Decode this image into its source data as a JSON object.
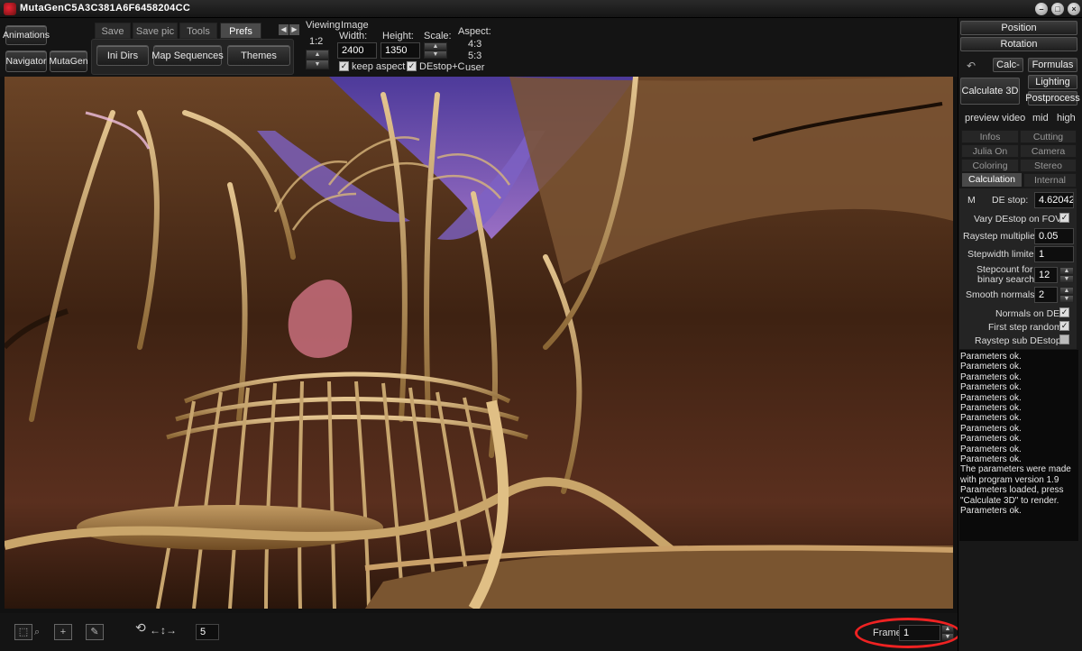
{
  "window": {
    "title": "MutaGenC5A3C381A6F6458204CC"
  },
  "left_buttons": {
    "animations": "Animations",
    "navigator": "Navigator",
    "mutagen": "MutaGen"
  },
  "tabs": [
    {
      "label": "Save",
      "active": false
    },
    {
      "label": "Save pic",
      "active": false
    },
    {
      "label": "Tools",
      "active": false
    },
    {
      "label": "Prefs",
      "active": true
    }
  ],
  "prefs_buttons": {
    "ini_dirs": "Ini Dirs",
    "map_sequences": "Map Sequences",
    "themes": "Themes"
  },
  "viewing": {
    "label": "Viewing",
    "ratio": "1:2"
  },
  "image": {
    "label": "Image",
    "width_label": "Width:",
    "width": "2400",
    "height_label": "Height:",
    "height": "1350",
    "scale_label": "Scale:",
    "aspect_label": "Aspect:",
    "aspect_options": [
      "4:3",
      "5:3",
      "user"
    ],
    "keep_aspect_label": "keep aspect",
    "keep_aspect": true,
    "destop_label": "DEstop+C",
    "destop": true
  },
  "right": {
    "position": "Position",
    "rotation": "Rotation",
    "calc": "Calc-",
    "formulas": "Formulas",
    "calculate3d": "Calculate 3D",
    "lighting": "Lighting",
    "postprocess": "Postprocess",
    "quality": [
      "preview",
      "video",
      "mid",
      "high"
    ],
    "tabs": [
      {
        "label": "Infos",
        "active": false
      },
      {
        "label": "Cutting",
        "active": false
      },
      {
        "label": "Julia On",
        "active": false
      },
      {
        "label": "Camera",
        "active": false
      },
      {
        "label": "Coloring",
        "active": false
      },
      {
        "label": "Stereo",
        "active": false
      },
      {
        "label": "Calculation",
        "active": true
      },
      {
        "label": "Internal",
        "active": false
      }
    ]
  },
  "calc_params": {
    "m_label": "M",
    "de_stop_label": "DE stop:",
    "de_stop": "4.62042",
    "vary_label": "Vary DEstop on FOV:",
    "vary": true,
    "raystep_label": "Raystep multiplier:",
    "raystep": "0.05",
    "stepwidth_label": "Stepwidth limiter:",
    "stepwidth": "1",
    "stepcount_label_1": "Stepcount for",
    "stepcount_label_2": "binary search:",
    "stepcount": "12",
    "smooth_label": "Smooth  normals:",
    "smooth": "2",
    "normals_label": "Normals on DE:",
    "normals": true,
    "first_step_label": "First step random:",
    "first_step": true,
    "raystep_sub_label": "Raystep sub DEstop:",
    "raystep_sub": false
  },
  "log_lines": [
    "Parameters ok.",
    "Parameters ok.",
    "Parameters ok.",
    "Parameters ok.",
    "Parameters ok.",
    "Parameters ok.",
    "Parameters ok.",
    "Parameters ok.",
    "Parameters ok.",
    "Parameters ok.",
    "Parameters ok.",
    "The parameters were made",
    "with program version 1.9",
    "Parameters loaded, press",
    "\"Calculate 3D\" to render.",
    "Parameters ok."
  ],
  "bottom": {
    "step_value": "5",
    "frame_label": "Frame:",
    "frame_value": "1"
  },
  "icons": {
    "app": "mandelbulb-app-icon",
    "minimize": "minimize-icon",
    "maximize": "maximize-icon",
    "close": "close-icon"
  },
  "colors": {
    "accent_highlight": "#e22222",
    "sky_purple": "#6a4fb0",
    "sculpture_gold": "#c9a56a"
  }
}
